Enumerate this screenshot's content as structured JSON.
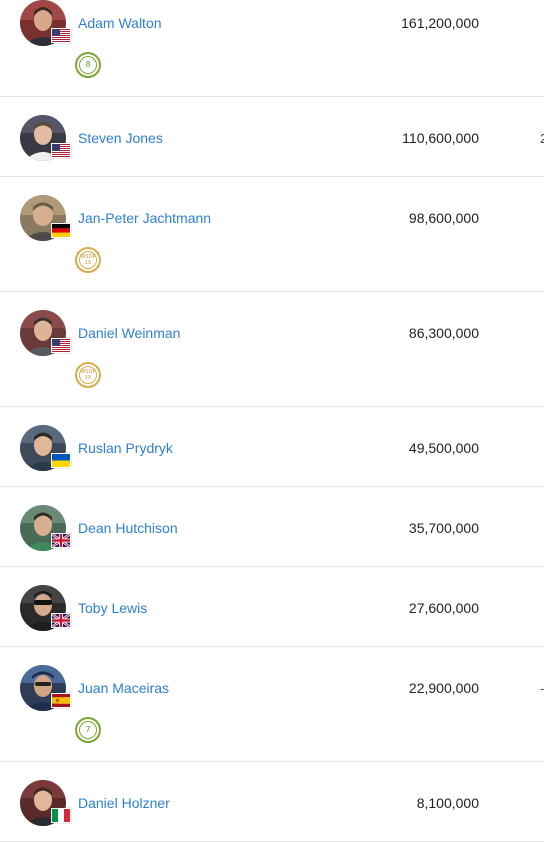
{
  "players": [
    {
      "name": "Adam Walton",
      "amount": "161,200,000",
      "flag": "us",
      "badge": {
        "type": "green",
        "text": "8"
      },
      "edge": "",
      "tone": "#5a3a3a"
    },
    {
      "name": "Steven Jones",
      "amount": "110,600,000",
      "flag": "us",
      "badge": null,
      "edge": "2",
      "tone": "#3a3a44"
    },
    {
      "name": "Jan-Peter Jachtmann",
      "amount": "98,600,000",
      "flag": "de",
      "badge": {
        "type": "gold",
        "text": "WSOP\n1X"
      },
      "edge": "",
      "tone": "#6b5a48"
    },
    {
      "name": "Daniel Weinman",
      "amount": "86,300,000",
      "flag": "us",
      "badge": {
        "type": "gold",
        "text": "WSOP\n1X"
      },
      "edge": "",
      "tone": "#4a4040"
    },
    {
      "name": "Ruslan Prydryk",
      "amount": "49,500,000",
      "flag": "ua",
      "badge": null,
      "edge": "",
      "tone": "#3e4a5a"
    },
    {
      "name": "Dean Hutchison",
      "amount": "35,700,000",
      "flag": "gb",
      "badge": null,
      "edge": "",
      "tone": "#3e5a48"
    },
    {
      "name": "Toby Lewis",
      "amount": "27,600,000",
      "flag": "gb",
      "badge": null,
      "edge": "",
      "tone": "#2a2a2a"
    },
    {
      "name": "Juan Maceiras",
      "amount": "22,900,000",
      "flag": "es",
      "badge": {
        "type": "green",
        "text": "7"
      },
      "edge": "-",
      "tone": "#2e3e5a"
    },
    {
      "name": "Daniel Holzner",
      "amount": "8,100,000",
      "flag": "it",
      "badge": null,
      "edge": "",
      "tone": "#4a2a2a"
    }
  ]
}
